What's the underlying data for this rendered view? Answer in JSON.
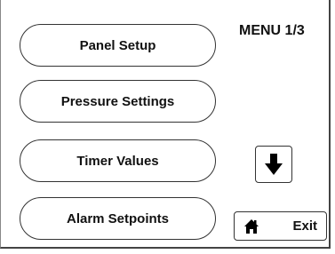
{
  "menu": {
    "title": "MENU 1/3",
    "buttons": [
      {
        "label": "Panel Setup"
      },
      {
        "label": "Pressure Settings"
      },
      {
        "label": "Timer Values"
      },
      {
        "label": "Alarm Setpoints"
      }
    ]
  },
  "nav": {
    "down_icon": "arrow-down-icon",
    "exit_icon": "home-icon",
    "exit_label": "Exit"
  }
}
